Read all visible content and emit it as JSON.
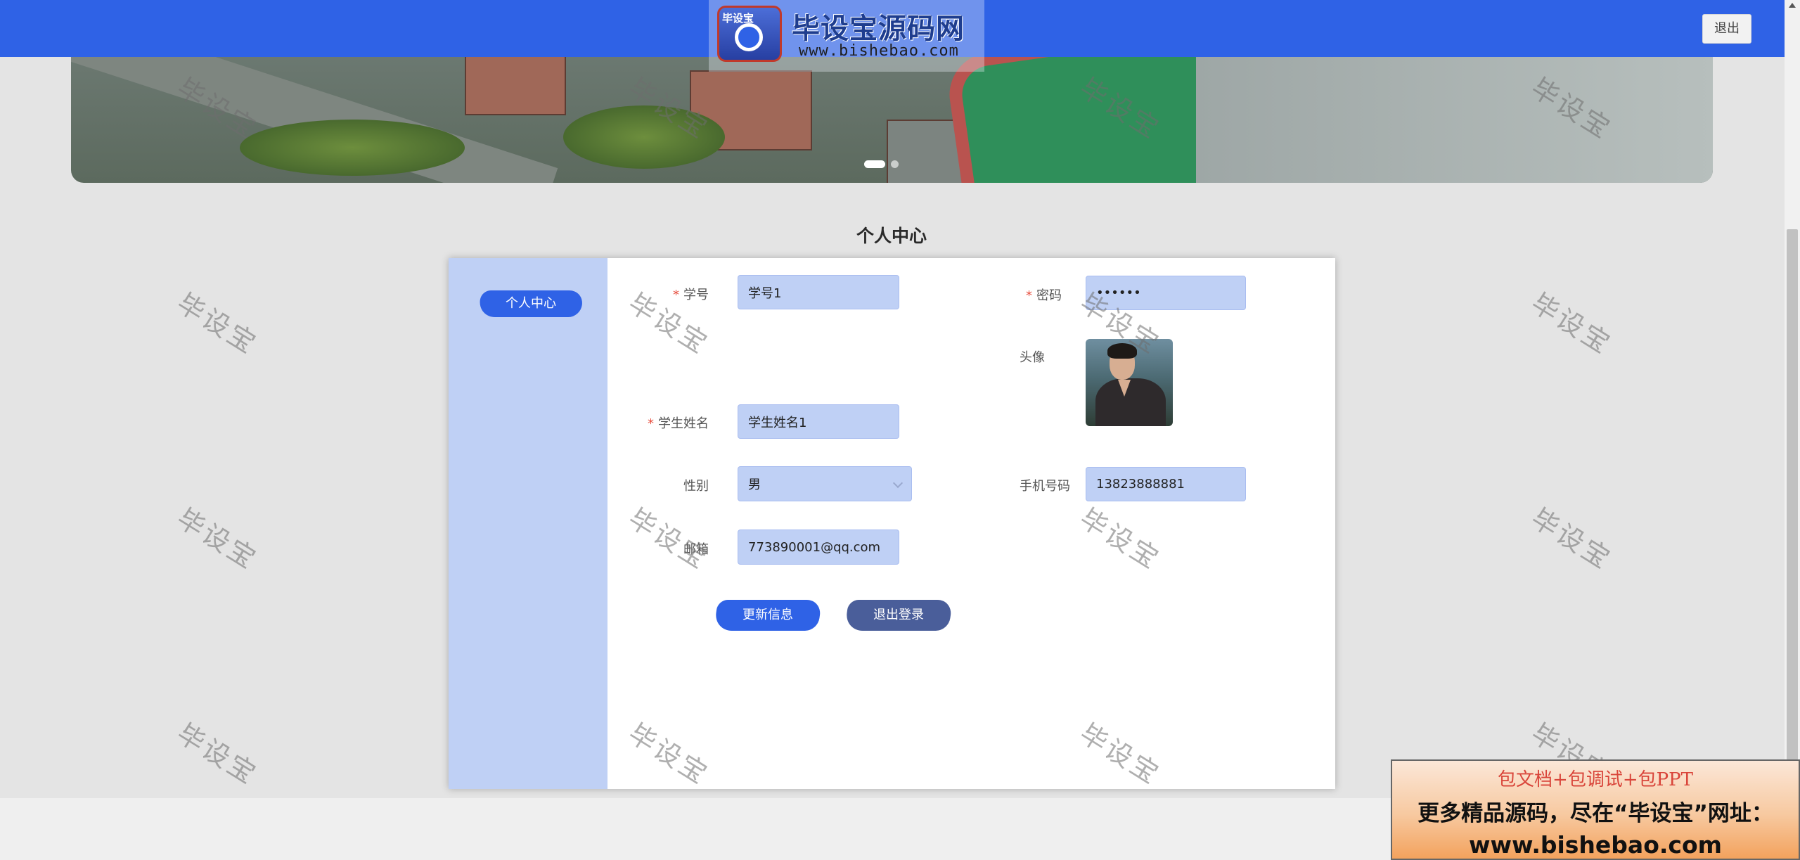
{
  "header": {
    "logout_label": "退出",
    "logo": {
      "title": "毕设宝源码网",
      "url": "www.bishebao.com",
      "badge": "毕设宝"
    }
  },
  "page": {
    "title": "个人中心"
  },
  "sidebar": {
    "items": [
      {
        "label": "个人中心"
      }
    ]
  },
  "form": {
    "student_id": {
      "label": "学号",
      "value": "学号1"
    },
    "password": {
      "label": "密码",
      "value": "••••••"
    },
    "avatar": {
      "label": "头像"
    },
    "student_name": {
      "label": "学生姓名",
      "value": "学生姓名1"
    },
    "gender": {
      "label": "性别",
      "value": "男"
    },
    "phone": {
      "label": "手机号码",
      "value": "13823888881"
    },
    "email": {
      "label": "邮箱",
      "value": "773890001@qq.com"
    },
    "update_label": "更新信息",
    "logout_label": "退出登录"
  },
  "watermark": "毕设宝",
  "promo": {
    "line1": "包文档+包调试+包PPT",
    "line2": "更多精品源码，尽在“毕设宝”网址：",
    "line3": "www.bishebao.com"
  },
  "colors": {
    "primary": "#2f62e6",
    "sidebar": "#bfd0f5",
    "required": "#e74c3c"
  }
}
